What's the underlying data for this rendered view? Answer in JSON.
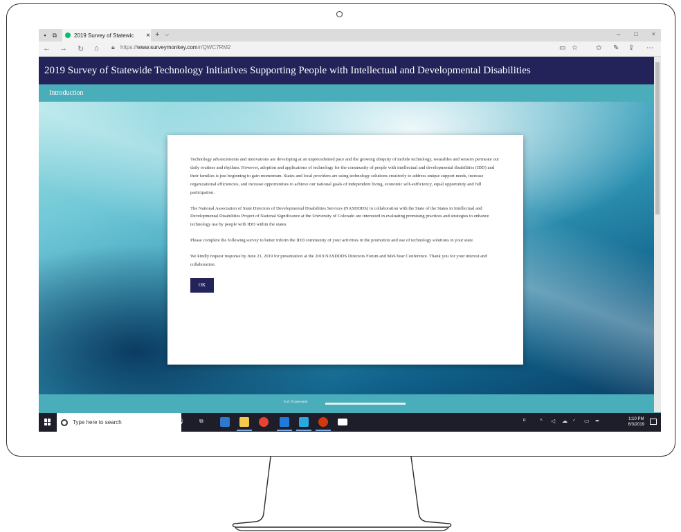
{
  "browser": {
    "tab_title": "2019 Survey of Statewic",
    "tab_close": "×",
    "new_tab": "+",
    "tab_dropdown": "⌵",
    "url_prefix": "https://",
    "url_host": "www.surveymonkey.com",
    "url_path": "/r/QWC7RM2",
    "window_buttons": [
      "–",
      "□",
      "×"
    ],
    "nav_icons": [
      "back-icon",
      "forward-icon",
      "refresh-icon",
      "home-icon"
    ],
    "right_icons": [
      "reading-view-icon",
      "favorite-star-icon",
      "favorites-hub-icon",
      "pen-icon",
      "share-icon",
      "more-icon"
    ]
  },
  "page": {
    "header_title": "2019 Survey of Statewide Technology Initiatives Supporting People with Intellectual and Developmental Disabilities",
    "subnav_label": "Introduction",
    "paragraphs": [
      "Technology advancements and innovations are developing at an unprecedented pace and the growing ubiquity of mobile technology, wearables and sensors permeate our daily routines and rhythms. However, adoption and applications of technology for the community of people with intellectual and developmental disabilities (IDD) and their families is just beginning to gain momentum. States and local providers are using technology solutions creatively to address unique support needs, increase organizational efficiencies, and increase opportunities to achieve our national goals of independent living, economic self-sufficiency, equal opportunity and full participation.",
      "The National Association of State Directors of Developmental Disabilities Services (NASDDDS) in collaboration with the State of the States in Intellectual and Developmental Disabilities Project of National Significance at the University of Colorado are interested in evaluating promising practices and strategies to enhance technology use by people with IDD within the states.",
      "Please complete the following survey to better inform the IDD community of your activities in the promotion and use of technology solutions in your state.",
      "We kindly request response by June 21, 2019 for presentation at the 2019 NASDDDS Directors Forum and Mid-Year Conference. Thank you for your interest and collaboration."
    ],
    "ok_label": "OK",
    "progress_text": "0 of 19 answered",
    "progress_fraction": 0
  },
  "taskbar": {
    "search_placeholder": "Type here to search",
    "clock_time": "1:10 PM",
    "clock_date": "6/3/2019"
  },
  "colors": {
    "header_navy": "#23235a",
    "teal": "#4aadba",
    "surveymonkey_green": "#00bf6f"
  }
}
